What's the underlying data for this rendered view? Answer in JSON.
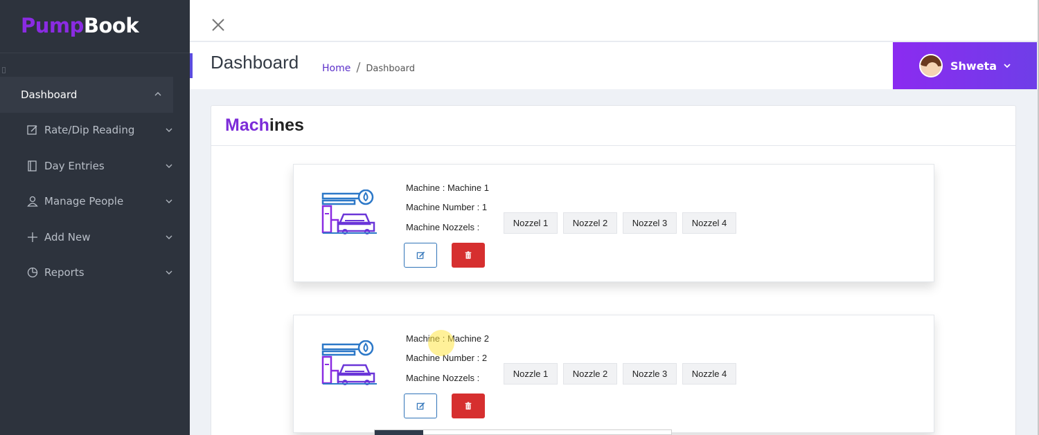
{
  "brand": {
    "part1": "Pump",
    "part2": "Book"
  },
  "sidebar": {
    "active": {
      "label": "Dashboard"
    },
    "items": [
      {
        "label": "Rate/Dip Reading",
        "icon": "edit-icon"
      },
      {
        "label": "Day Entries",
        "icon": "book-icon"
      },
      {
        "label": "Manage People",
        "icon": "user-icon"
      },
      {
        "label": "Add New",
        "icon": "plus-icon"
      },
      {
        "label": "Reports",
        "icon": "pie-chart-icon"
      }
    ]
  },
  "header": {
    "title": "Dashboard",
    "breadcrumb": {
      "home": "Home",
      "separator": "/",
      "current": "Dashboard"
    },
    "user": {
      "name": "Shweta"
    }
  },
  "panel": {
    "title_part1": "Mach",
    "title_part2": "ines"
  },
  "machines": [
    {
      "machine": "Machine :  Machine 1",
      "number": "Machine Number : 1",
      "nozzels_label": "Machine Nozzels :",
      "nozzles": [
        "Nozzel 1",
        "Nozzel 2",
        "Nozzel 3",
        "Nozzel 4"
      ]
    },
    {
      "machine": "Machine :  Machine 2",
      "number": "Machine Number : 2",
      "nozzels_label": "Machine Nozzels :",
      "nozzles": [
        "Nozzle 1",
        "Nozzle 2",
        "Nozzle 3",
        "Nozzle 4"
      ]
    }
  ],
  "colors": {
    "accent": "#8a2be2",
    "sidebar": "#2d333d",
    "delete": "#d62f2f",
    "edit_border": "#2f73b8"
  }
}
